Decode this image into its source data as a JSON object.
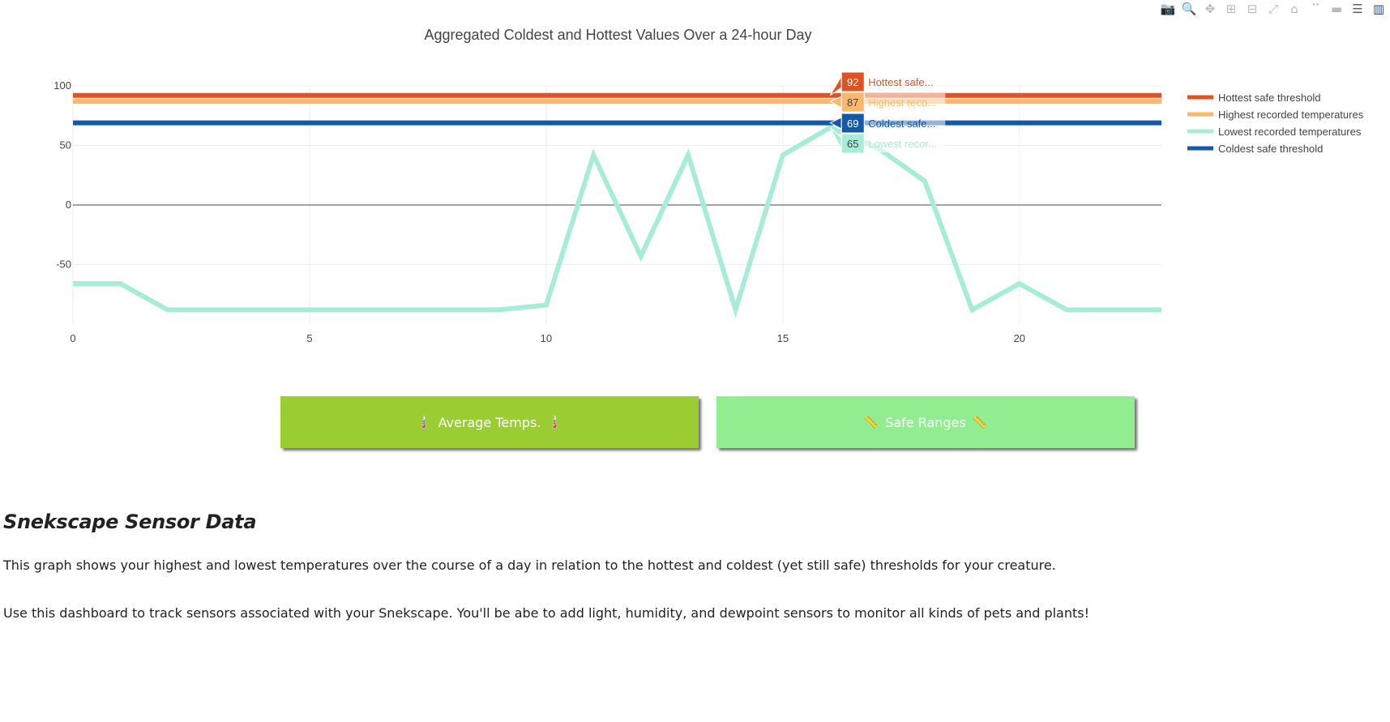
{
  "modebar": {
    "icons": [
      {
        "name": "camera-icon",
        "glyph": "📷"
      },
      {
        "name": "zoom-icon",
        "glyph": "🔍"
      },
      {
        "name": "pan-icon",
        "glyph": "✥"
      },
      {
        "name": "zoom-in-icon",
        "glyph": "⊞"
      },
      {
        "name": "zoom-out-icon",
        "glyph": "⊟"
      },
      {
        "name": "autoscale-icon",
        "glyph": "⤢"
      },
      {
        "name": "home-icon",
        "glyph": "⌂"
      },
      {
        "name": "spike-lines-icon",
        "glyph": "⠉"
      },
      {
        "name": "hover-closest-icon",
        "glyph": "▬"
      },
      {
        "name": "hover-compare-icon",
        "glyph": "☰"
      },
      {
        "name": "plotly-logo-icon",
        "glyph": "▥"
      }
    ]
  },
  "chart_data": {
    "type": "line",
    "title": "Aggregated Coldest and Hottest Values Over a 24-hour Day",
    "xlim": [
      0,
      23
    ],
    "ylim": [
      -100,
      100
    ],
    "x_ticks": [
      0,
      5,
      10,
      15,
      20
    ],
    "y_ticks": [
      100,
      50,
      0,
      -50
    ],
    "grid": true,
    "legend_position": "right",
    "x": [
      0,
      1,
      2,
      3,
      4,
      5,
      6,
      7,
      8,
      9,
      10,
      11,
      12,
      13,
      14,
      15,
      16,
      17,
      18,
      19,
      20,
      21,
      22,
      23
    ],
    "series": [
      {
        "name": "Hottest safe threshold",
        "color": "#e15223",
        "values": [
          92,
          92,
          92,
          92,
          92,
          92,
          92,
          92,
          92,
          92,
          92,
          92,
          92,
          92,
          92,
          92,
          92,
          92,
          92,
          92,
          92,
          92,
          92,
          92
        ]
      },
      {
        "name": "Highest recorded temperatures",
        "color": "#fbb86b",
        "values": [
          87,
          87,
          87,
          87,
          87,
          87,
          87,
          87,
          87,
          87,
          87,
          87,
          87,
          87,
          87,
          87,
          87,
          87,
          87,
          87,
          87,
          87,
          87,
          87
        ]
      },
      {
        "name": "Lowest recorded temperatures",
        "color": "#a6ecd8",
        "values": [
          -66,
          -66,
          -88,
          -88,
          -88,
          -88,
          -88,
          -88,
          -88,
          -88,
          -84,
          42,
          -43,
          42,
          -88,
          42,
          65,
          48,
          20,
          -88,
          -66,
          -88,
          -88,
          -88
        ]
      },
      {
        "name": "Coldest safe threshold",
        "color": "#1458a8",
        "values": [
          69,
          69,
          69,
          69,
          69,
          69,
          69,
          69,
          69,
          69,
          69,
          69,
          69,
          69,
          69,
          69,
          69,
          69,
          69,
          69,
          69,
          69,
          69,
          69
        ]
      }
    ],
    "legend_order": [
      0,
      1,
      2,
      3
    ],
    "hover": {
      "x": 16,
      "labels": [
        {
          "series": 0,
          "value": "92",
          "text": "Hottest safe...",
          "color": "#e15223",
          "fg": "#ffffff"
        },
        {
          "series": 1,
          "value": "87",
          "text": "Highest reco...",
          "color": "#fbb86b",
          "fg": "#444444"
        },
        {
          "series": 3,
          "value": "69",
          "text": "Coldest safe...",
          "color": "#1458a8",
          "fg": "#ffffff"
        },
        {
          "series": 2,
          "value": "65",
          "text": "Lowest recor...",
          "color": "#a6ecd8",
          "fg": "#444444"
        }
      ]
    }
  },
  "buttons": {
    "average": {
      "label": "Average Temps.",
      "emoji": "🌡️"
    },
    "safe": {
      "label": "Safe Ranges",
      "emoji": "📏"
    }
  },
  "description": {
    "heading": "Snekscape Sensor Data",
    "p1": "This graph shows your highest and lowest temperatures over the course of a day in relation to the hottest and coldest (yet still safe) thresholds for your creature.",
    "p2": "Use this dashboard to track sensors associated with your Snekscape. You'll be abe to add light, humidity, and dewpoint sensors to monitor all kinds of pets and plants!"
  }
}
